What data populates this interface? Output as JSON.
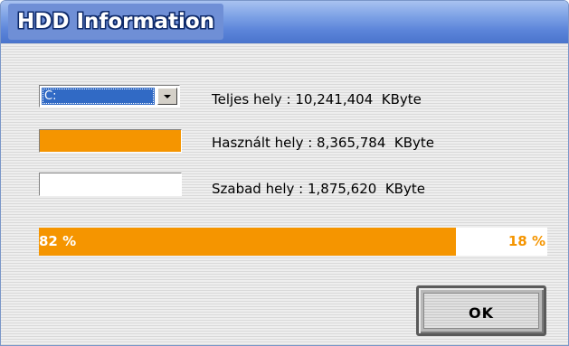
{
  "window": {
    "title": "HDD Information"
  },
  "drive": {
    "selected": "C:"
  },
  "stats": {
    "total": "Teljes hely : 10,241,404  KByte",
    "used": "Használt hely : 8,365,784  KByte",
    "free": "Szabad hely : 1,875,620  KByte"
  },
  "usage": {
    "used_fraction": 0.82,
    "used_label": "82 %",
    "free_label": "18 %"
  },
  "buttons": {
    "ok_label": "OK"
  },
  "colors": {
    "used": "#f59500",
    "free": "#ffffff",
    "title_bar": "#5b84d9",
    "selection": "#316ac5"
  }
}
